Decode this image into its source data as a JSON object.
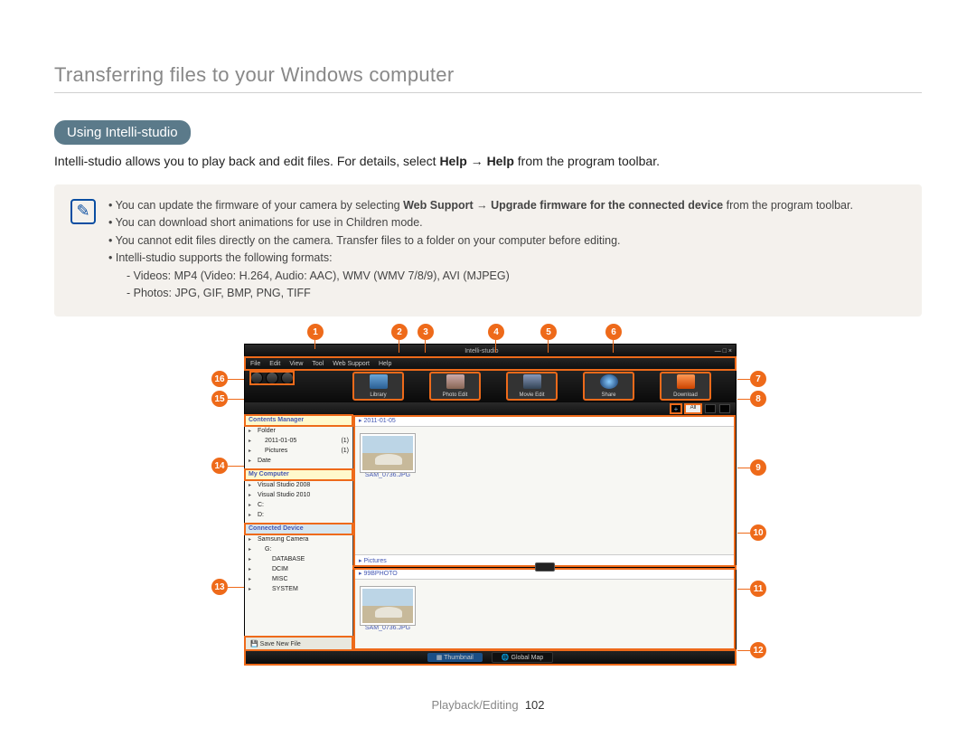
{
  "page": {
    "title": "Transferring files to your Windows computer",
    "section_pill": "Using Intelli-studio",
    "intro_pre": "Intelli-studio allows you to play back and edit files. For details, select ",
    "intro_b1": "Help",
    "intro_arrow": " → ",
    "intro_b2": "Help",
    "intro_post": " from the program toolbar.",
    "footer_section": "Playback/Editing",
    "footer_page": "102"
  },
  "note": {
    "line1_pre": "You can update the firmware of your camera by selecting ",
    "line1_b1": "Web Support",
    "line1_arrow": " → ",
    "line1_b2": "Upgrade firmware for the connected device",
    "line1_post": " from the program toolbar.",
    "line2": "You can download short animations for use in Children mode.",
    "line3": "You cannot edit files directly on the camera. Transfer files to a folder on your computer before editing.",
    "line4": "Intelli-studio supports the following formats:",
    "sub1": "Videos: MP4 (Video: H.264, Audio: AAC), WMV (WMV 7/8/9), AVI (MJPEG)",
    "sub2": "Photos: JPG, GIF, BMP, PNG, TIFF"
  },
  "app": {
    "window_title": "Intelli-studio",
    "window_controls": "— □ ×",
    "menu": [
      "File",
      "Edit",
      "View",
      "Tool",
      "Web Support",
      "Help"
    ],
    "main_buttons": [
      "Library",
      "Photo Edit",
      "Movie Edit",
      "Share",
      "Download"
    ],
    "view_all": "All",
    "contents_manager": "Contents Manager",
    "folders": {
      "root": "Folder",
      "sub1": "2011-01-05",
      "count1": "(1)",
      "sub2": "Pictures",
      "count2": "(1)",
      "root2": "Date"
    },
    "my_computer": "My Computer",
    "mc_items": [
      "Visual Studio 2008",
      "Visual Studio 2010",
      "C:",
      "D:"
    ],
    "connected_device": "Connected Device",
    "cd_items": [
      "Samsung Camera",
      "G:",
      "DATABASE",
      "DCIM",
      "MISC",
      "SYSTEM"
    ],
    "save_new": "Save New File",
    "crumb_top": "2011-01-05",
    "thumb1": "SAM_0736.JPG",
    "pictures_label": "Pictures",
    "crumb_low": "99BPHOTO",
    "thumb2": "SAM_0736.JPG",
    "foot_thumb": "Thumbnail",
    "foot_map": "Global Map"
  },
  "callouts": [
    "1",
    "2",
    "3",
    "4",
    "5",
    "6",
    "7",
    "8",
    "9",
    "10",
    "11",
    "12",
    "13",
    "14",
    "15",
    "16"
  ]
}
